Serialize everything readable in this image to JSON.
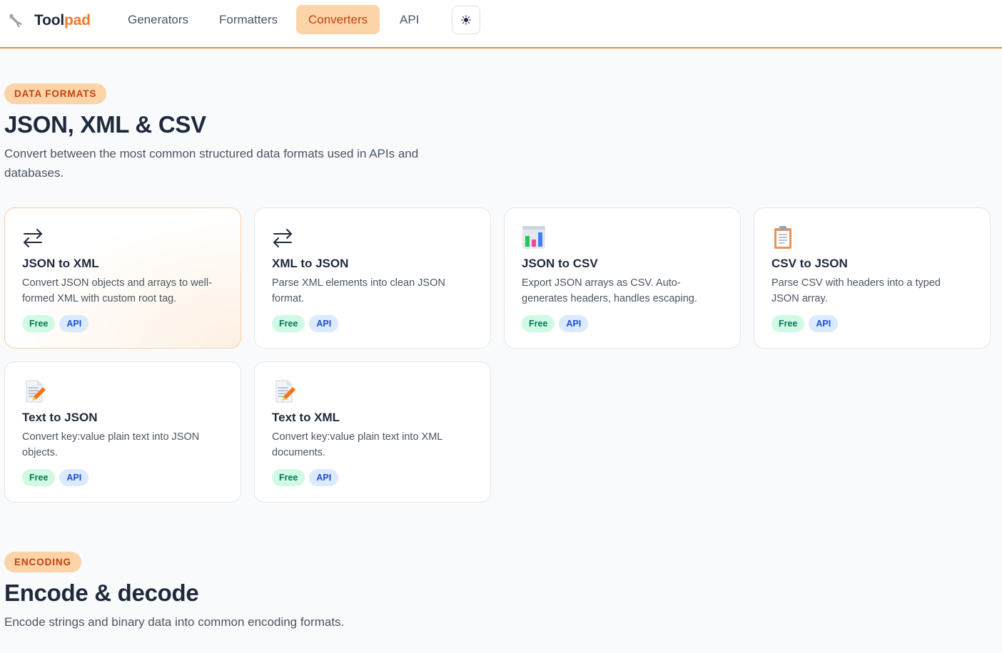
{
  "brand": {
    "name_part1": "Tool",
    "name_part2": "pad",
    "icon": "wrench-icon"
  },
  "nav": {
    "items": [
      {
        "label": "Generators",
        "active": false
      },
      {
        "label": "Formatters",
        "active": false
      },
      {
        "label": "Converters",
        "active": true
      },
      {
        "label": "API",
        "active": false
      }
    ],
    "theme_toggle_icon": "sun-icon"
  },
  "colors": {
    "accent": "#f07a2a",
    "accent_soft": "#fdd3a8",
    "accent_text": "#c2410c",
    "free_tag": "#d1fae5",
    "api_tag": "#dbeafe"
  },
  "sections": [
    {
      "eyebrow": "DATA FORMATS",
      "title": "JSON, XML & CSV",
      "description_line1": "Convert between the most common structured data formats used in APIs and",
      "description_line2": "databases.",
      "cards": [
        {
          "icon": "swap-arrows-icon",
          "title": "JSON to XML",
          "desc_line1": "Convert JSON objects and arrays to well-",
          "desc_line2": "formed XML with custom root tag.",
          "tags": [
            "Free",
            "API"
          ]
        },
        {
          "icon": "swap-arrows-icon",
          "title": "XML to JSON",
          "desc_line1": "Parse XML elements into clean JSON",
          "desc_line2": "format.",
          "tags": [
            "Free",
            "API"
          ]
        },
        {
          "icon": "bar-chart-icon",
          "title": "JSON to CSV",
          "desc_line1": "Export JSON arrays as CSV. Auto-",
          "desc_line2": "generates headers, handles escaping.",
          "tags": [
            "Free",
            "API"
          ]
        },
        {
          "icon": "clipboard-icon",
          "title": "CSV to JSON",
          "desc_line1": "Parse CSV with headers into a typed",
          "desc_line2": "JSON array.",
          "tags": [
            "Free",
            "API"
          ]
        },
        {
          "icon": "memo-icon",
          "title": "Text to JSON",
          "desc_line1": "Convert key:value plain text into JSON",
          "desc_line2": "objects.",
          "tags": [
            "Free",
            "API"
          ]
        },
        {
          "icon": "memo-icon",
          "title": "Text to XML",
          "desc_line1": "Convert key:value plain text into XML",
          "desc_line2": "documents.",
          "tags": [
            "Free",
            "API"
          ]
        }
      ]
    },
    {
      "eyebrow": "ENCODING",
      "title": "Encode & decode",
      "description_line1": "Encode strings and binary data into common encoding formats."
    }
  ]
}
